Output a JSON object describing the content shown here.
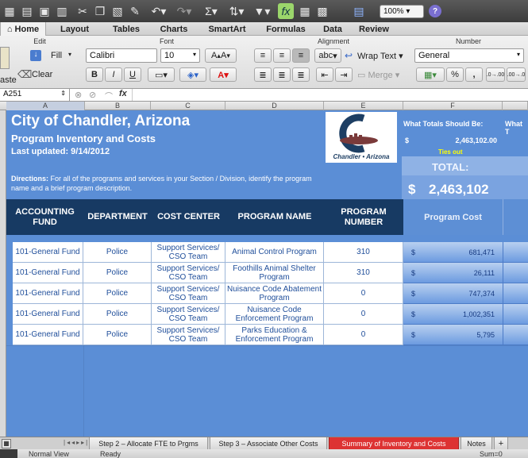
{
  "toolbar": {
    "zoom": "100%"
  },
  "ribbon_tabs": [
    "Home",
    "Layout",
    "Tables",
    "Charts",
    "SmartArt",
    "Formulas",
    "Data",
    "Review"
  ],
  "ribbon": {
    "groups": {
      "edit": "Edit",
      "font": "Font",
      "alignment": "Alignment",
      "number": "Number"
    },
    "fill_label": "Fill",
    "clear_label": "Clear",
    "paste_label": "aste",
    "font_name": "Calibri",
    "font_size": "10",
    "wrap_text_label": "Wrap Text",
    "merge_label": "Merge",
    "number_format": "General",
    "abc_label": "abc",
    "bold": "B",
    "italic": "I",
    "underline": "U",
    "percent": "%",
    "comma": ","
  },
  "formula_bar": {
    "cell_ref": "A251",
    "fx": "fx",
    "value": ""
  },
  "columns": [
    "A",
    "B",
    "C",
    "D",
    "E",
    "F"
  ],
  "sheet": {
    "title": "City of Chandler, Arizona",
    "subtitle": "Program Inventory and Costs",
    "last_updated": "Last updated:  9/14/2012",
    "directions_bold": "Directions:",
    "directions_text": " For all of the programs and services in your Section / Division, identify the program name and a brief program description.",
    "logo_text": "Chandler • Arizona",
    "what_totals_label": "What Totals Should Be:",
    "what_totals_clip": "What T",
    "dollar": "$",
    "expected_total": "2,463,102.00",
    "ties_out": "Ties out",
    "total_label": "TOTAL:",
    "total_value": "2,463,102"
  },
  "table": {
    "headers": [
      "ACCOUNTING FUND",
      "DEPARTMENT",
      "COST CENTER",
      "PROGRAM NAME",
      "PROGRAM NUMBER",
      "Program Cost"
    ],
    "rows": [
      {
        "fund": "101-General Fund",
        "dept": "Police",
        "cost_center": "Support Services/ CSO Team",
        "program": "Animal Control Program",
        "number": "310",
        "cost": "681,471"
      },
      {
        "fund": "101-General Fund",
        "dept": "Police",
        "cost_center": "Support Services/ CSO Team",
        "program": "Foothills Animal Shelter Program",
        "number": "310",
        "cost": "26,111"
      },
      {
        "fund": "101-General Fund",
        "dept": "Police",
        "cost_center": "Support Services/ CSO Team",
        "program": "Nuisance Code Abatement Program",
        "number": "0",
        "cost": "747,374"
      },
      {
        "fund": "101-General Fund",
        "dept": "Police",
        "cost_center": "Support Services/ CSO Team",
        "program": "Nuisance Code Enforcement Program",
        "number": "0",
        "cost": "1,002,351"
      },
      {
        "fund": "101-General Fund",
        "dept": "Police",
        "cost_center": "Support Services/ CSO Team",
        "program": "Parks Education & Enforcement Program",
        "number": "0",
        "cost": "5,795"
      }
    ]
  },
  "sheet_tabs": [
    "Step 2 – Allocate FTE to Prgms",
    "Step 3 – Associate Other Costs",
    "Summary of Inventory and Costs",
    "Notes"
  ],
  "status": {
    "view": "Normal View",
    "state": "Ready",
    "sum": "Sum=0"
  },
  "colors": {
    "sheet_blue": "#5b8ed6",
    "header_navy": "#173a63",
    "active_tab_red": "#dd3333",
    "link_blue": "#1f4e9a",
    "ties_out_yellow": "#ffff00"
  }
}
